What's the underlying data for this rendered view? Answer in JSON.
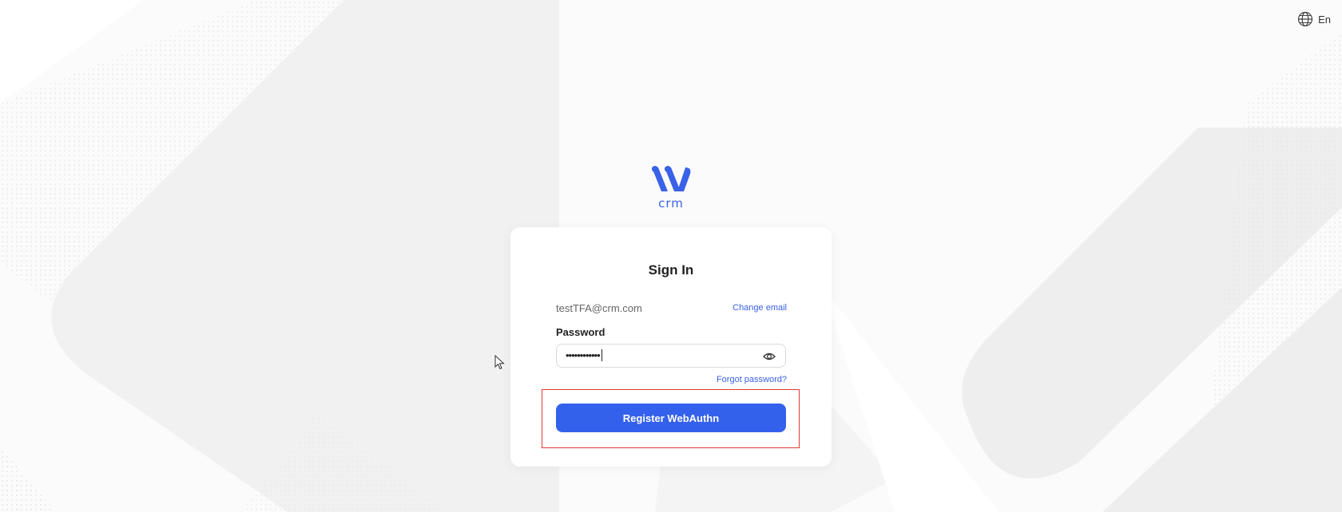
{
  "language": {
    "label": "En",
    "icon": "globe-icon"
  },
  "logo": {
    "text": "crm",
    "color": "#3a62e8"
  },
  "signin": {
    "title": "Sign In",
    "email": "testTFA@crm.com",
    "change_email_label": "Change email",
    "password_label": "Password",
    "password_value": "••••••••••••",
    "toggle_icon": "eye-icon",
    "forgot_password_label": "Forgot password?",
    "submit_label": "Register WebAuthn"
  },
  "colors": {
    "accent": "#3461eb",
    "highlight": "#e53935",
    "background": "#fafafa"
  }
}
